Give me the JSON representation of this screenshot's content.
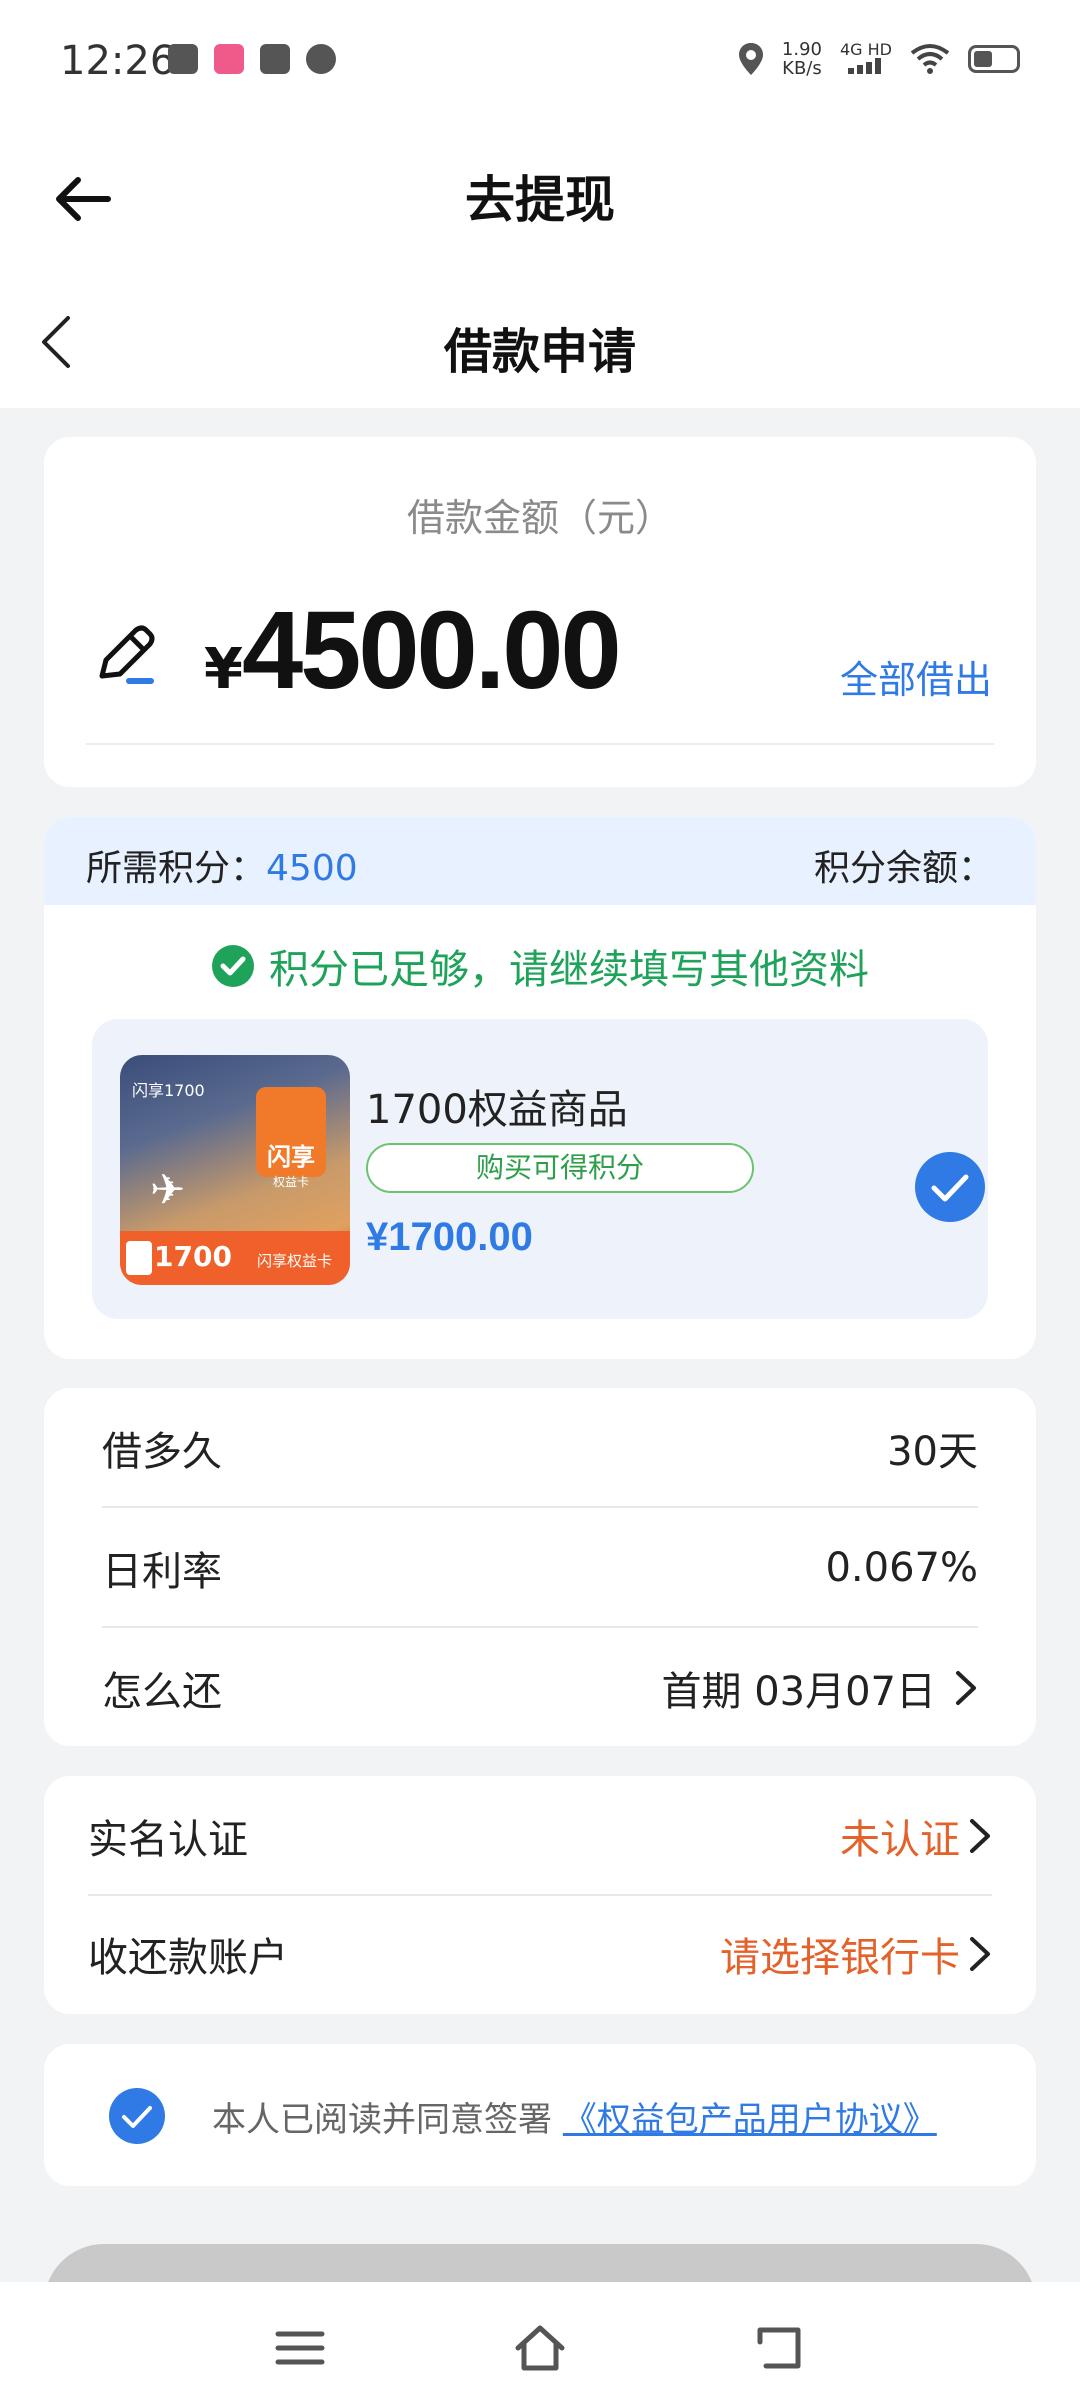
{
  "status_bar": {
    "time": "12:26",
    "speed_value": "1.90",
    "speed_unit": "KB/s",
    "network": "4G HD"
  },
  "header_primary": {
    "title": "去提现"
  },
  "header_secondary": {
    "title": "借款申请"
  },
  "amount": {
    "label": "借款金额（元）",
    "currency": "¥",
    "value": "4500.00",
    "borrow_all_label": "全部借出"
  },
  "points": {
    "required_label": "所需积分：",
    "required_value": "4500",
    "balance_label": "积分余额：",
    "status_text": "积分已足够，请继续填写其他资料"
  },
  "product": {
    "image_tag": "闪享1700",
    "image_badge": "闪享",
    "image_badge_sub": "权益卡",
    "image_strip_number": "1700",
    "image_strip_text": "闪享权益卡",
    "name": "1700权益商品",
    "pill": "购买可得积分",
    "price": "¥1700.00",
    "selected": true
  },
  "terms": [
    {
      "label": "借多久",
      "value": "30天"
    },
    {
      "label": "日利率",
      "value": "0.067%"
    },
    {
      "label": "怎么还",
      "value": "首期 03月07日"
    }
  ],
  "verify": [
    {
      "label": "实名认证",
      "value": "未认证"
    },
    {
      "label": "收还款账户",
      "value": "请选择银行卡"
    }
  ],
  "agreement": {
    "text": "本人已阅读并同意签署 ",
    "link": "《权益包产品用户协议》",
    "checked": true
  },
  "colors": {
    "accent_blue": "#2f7ae5",
    "success_green": "#1fa35a",
    "warning_orange": "#e4622a"
  },
  "icons": {
    "back_primary": "arrow-left-icon",
    "back_secondary": "chevron-left-icon",
    "edit": "pen-icon",
    "ok": "check-circle-icon",
    "nav_menu": "menu-icon",
    "nav_home": "home-icon",
    "nav_back": "back-icon"
  }
}
